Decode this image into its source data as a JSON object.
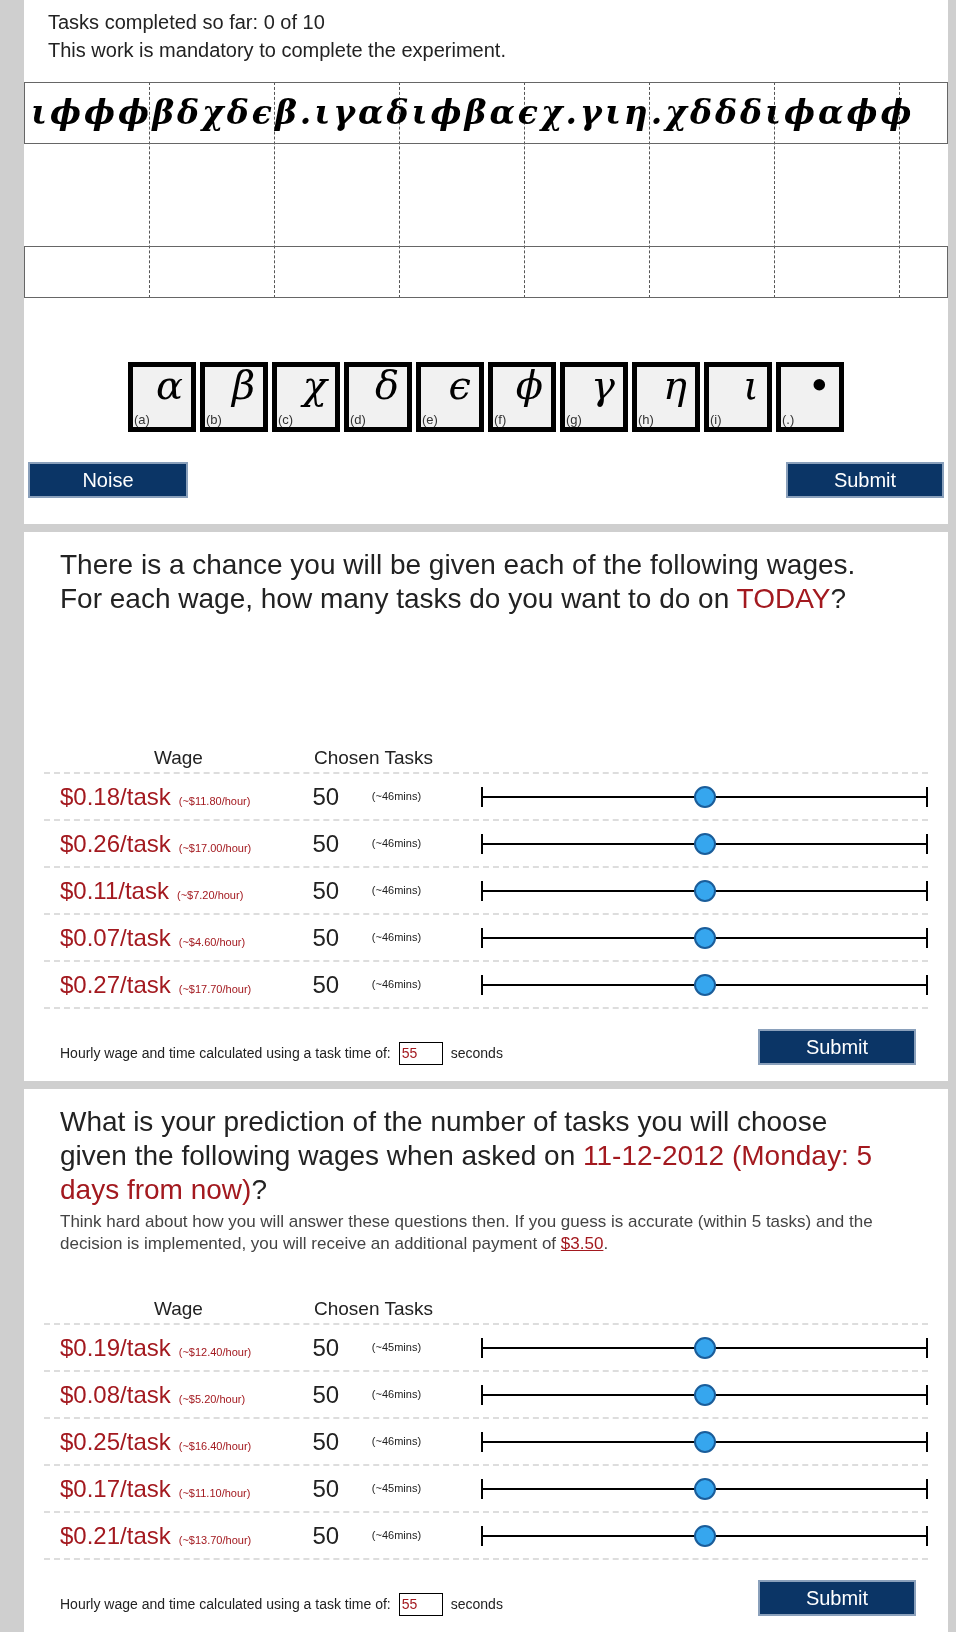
{
  "task_panel": {
    "progress": "Tasks completed so far: 0 of 10",
    "notice": "This work is mandatory to complete the experiment.",
    "cipher_text": "ιϕϕϕβδχδϵβ.ιγαδιϕβαϵχ.γιη.χδδδιϕαϕϕ",
    "symbol_keys": [
      {
        "symbol": "α",
        "label": "(a)"
      },
      {
        "symbol": "β",
        "label": "(b)"
      },
      {
        "symbol": "χ",
        "label": "(c)"
      },
      {
        "symbol": "δ",
        "label": "(d)"
      },
      {
        "symbol": "ϵ",
        "label": "(e)"
      },
      {
        "symbol": "ϕ",
        "label": "(f)"
      },
      {
        "symbol": "γ",
        "label": "(g)"
      },
      {
        "symbol": "η",
        "label": "(h)"
      },
      {
        "symbol": "ι",
        "label": "(i)"
      },
      {
        "symbol": "•",
        "label": "(.)"
      }
    ],
    "buttons": [
      "Noise",
      "Submit"
    ]
  },
  "wage_panels": [
    {
      "question": "There is a chance you will be given each of the following wages. For each wage, how many tasks do you want to do on **TODAY**?",
      "columns": [
        "Wage",
        "Chosen Tasks"
      ],
      "rows": [
        {
          "wage": "$0.18/task",
          "hourly": "(~$11.80/hour)",
          "tasks": "50",
          "time": "(~46mins)",
          "level": 0.5
        },
        {
          "wage": "$0.26/task",
          "hourly": "(~$17.00/hour)",
          "tasks": "50",
          "time": "(~46mins)",
          "level": 0.5
        },
        {
          "wage": "$0.11/task",
          "hourly": "(~$7.20/hour)",
          "tasks": "50",
          "time": "(~46mins)",
          "level": 0.5
        },
        {
          "wage": "$0.07/task",
          "hourly": "(~$4.60/hour)",
          "tasks": "50",
          "time": "(~46mins)",
          "level": 0.5
        },
        {
          "wage": "$0.27/task",
          "hourly": "(~$17.70/hour)",
          "tasks": "50",
          "time": "(~46mins)",
          "level": 0.5
        }
      ],
      "footer_label": "Hourly wage and time calculated using a task time of:",
      "task_time": "55",
      "footer_unit": "seconds",
      "button": "Submit"
    },
    {
      "question": "What is your prediction of the number of tasks you will choose given the following wages when asked on **11-12-2012 (Monday: 5 days from now)**?",
      "instructions": "Think hard about how you will answer these questions then.  If you guess is accurate (within 5 tasks) and the decision is implemented, you will receive an additional payment of",
      "bonus": "$3.50",
      "bonus_suffix": ".",
      "columns": [
        "Wage",
        "Chosen Tasks"
      ],
      "rows": [
        {
          "wage": "$0.19/task",
          "hourly": "(~$12.40/hour)",
          "tasks": "50",
          "time": "(~45mins)",
          "level": 0.5
        },
        {
          "wage": "$0.08/task",
          "hourly": "(~$5.20/hour)",
          "tasks": "50",
          "time": "(~46mins)",
          "level": 0.5
        },
        {
          "wage": "$0.25/task",
          "hourly": "(~$16.40/hour)",
          "tasks": "50",
          "time": "(~46mins)",
          "level": 0.5
        },
        {
          "wage": "$0.17/task",
          "hourly": "(~$11.10/hour)",
          "tasks": "50",
          "time": "(~45mins)",
          "level": 0.5
        },
        {
          "wage": "$0.21/task",
          "hourly": "(~$13.70/hour)",
          "tasks": "50",
          "time": "(~46mins)",
          "level": 0.5
        }
      ],
      "footer_label": "Hourly wage and time calculated using a task time of:",
      "task_time": "55",
      "footer_unit": "seconds",
      "button": "Submit"
    }
  ]
}
